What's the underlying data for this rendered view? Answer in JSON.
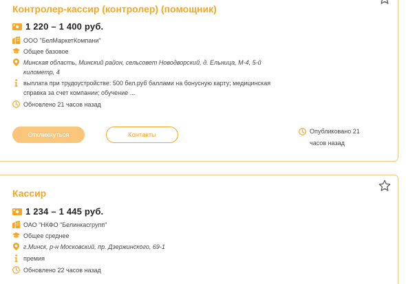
{
  "accent_color": "#f5a623",
  "vacancies": [
    {
      "title": "Контролер-кассир (контролер) (помощник)",
      "salary": "1 220 – 1 400 руб.",
      "company": "ООО \"БелМаркетКомпани\"",
      "education": "Общее базовое",
      "address_line1": "Минская область, Минский район, сельсовет Новодворский, д. Ельница, М-4, 5-й",
      "address_line2": "километр, 4",
      "benefits_line1": "выплата при трудоустройстве: 500 бел.руб баллами на бонусную карту; медицинская",
      "benefits_line2": "справка за счет компании; обучение ...",
      "updated": "Обновлено 21 часов назад",
      "apply_label": "Откликнуться",
      "contacts_label": "Контакты",
      "published_line1": "Опубликовано 21",
      "published_line2": "часов назад"
    },
    {
      "title": "Кассир",
      "salary": "1 234 – 1 445 руб.",
      "company": "ОАО \"НКФО \"Белинкасгрупп\"",
      "education": "Общее среднее",
      "address": "г.Минск, р-н Московский, пр. Дзержинского, 69-1",
      "benefits": "премия",
      "updated": "Обновлено 22 часов назад"
    }
  ],
  "icons": {
    "salary": "money-icon",
    "company": "building-icon",
    "education": "graduation-cap-icon",
    "address": "location-pin-icon",
    "benefits": "info-icon",
    "updated": "clock-icon",
    "favorite": "star-icon"
  }
}
